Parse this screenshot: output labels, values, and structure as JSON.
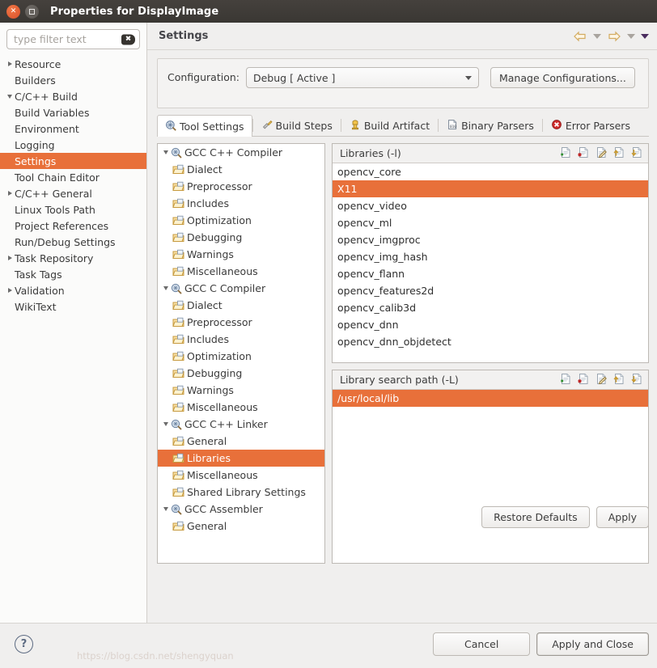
{
  "window": {
    "title": "Properties for DisplayImage",
    "close_icon": "close-icon",
    "maximize_icon": "maximize-icon"
  },
  "sidebar": {
    "filter": {
      "placeholder": "type filter text",
      "value": "",
      "clear_icon": "clear-icon"
    },
    "items": [
      {
        "label": "Resource",
        "expandable": true,
        "expanded": false,
        "indent": 0,
        "selected": false
      },
      {
        "label": "Builders",
        "expandable": false,
        "expanded": false,
        "indent": 0,
        "selected": false
      },
      {
        "label": "C/C++ Build",
        "expandable": true,
        "expanded": true,
        "indent": 0,
        "selected": false
      },
      {
        "label": "Build Variables",
        "expandable": false,
        "expanded": false,
        "indent": 1,
        "selected": false
      },
      {
        "label": "Environment",
        "expandable": false,
        "expanded": false,
        "indent": 1,
        "selected": false
      },
      {
        "label": "Logging",
        "expandable": false,
        "expanded": false,
        "indent": 1,
        "selected": false
      },
      {
        "label": "Settings",
        "expandable": false,
        "expanded": false,
        "indent": 1,
        "selected": true
      },
      {
        "label": "Tool Chain Editor",
        "expandable": false,
        "expanded": false,
        "indent": 1,
        "selected": false
      },
      {
        "label": "C/C++ General",
        "expandable": true,
        "expanded": false,
        "indent": 0,
        "selected": false
      },
      {
        "label": "Linux Tools Path",
        "expandable": false,
        "expanded": false,
        "indent": 0,
        "selected": false
      },
      {
        "label": "Project References",
        "expandable": false,
        "expanded": false,
        "indent": 0,
        "selected": false
      },
      {
        "label": "Run/Debug Settings",
        "expandable": false,
        "expanded": false,
        "indent": 0,
        "selected": false
      },
      {
        "label": "Task Repository",
        "expandable": true,
        "expanded": false,
        "indent": 0,
        "selected": false
      },
      {
        "label": "Task Tags",
        "expandable": false,
        "expanded": false,
        "indent": 0,
        "selected": false
      },
      {
        "label": "Validation",
        "expandable": true,
        "expanded": false,
        "indent": 0,
        "selected": false
      },
      {
        "label": "WikiText",
        "expandable": false,
        "expanded": false,
        "indent": 0,
        "selected": false
      }
    ]
  },
  "header": {
    "title": "Settings",
    "nav": {
      "back_icon": "back-arrow-icon",
      "back_menu_icon": "chevron-down-icon",
      "forward_icon": "forward-arrow-icon",
      "forward_menu_icon": "chevron-down-icon",
      "view_menu_icon": "view-menu-icon"
    }
  },
  "configuration": {
    "label": "Configuration:",
    "value": "Debug  [ Active ]",
    "dropdown_icon": "chevron-down-icon",
    "manage_button": "Manage Configurations..."
  },
  "tabs": [
    {
      "label": "Tool Settings",
      "icon": "tool-settings-icon",
      "active": true
    },
    {
      "label": "Build Steps",
      "icon": "build-steps-icon",
      "active": false
    },
    {
      "label": "Build Artifact",
      "icon": "build-artifact-icon",
      "active": false
    },
    {
      "label": "Binary Parsers",
      "icon": "binary-parsers-icon",
      "active": false
    },
    {
      "label": "Error Parsers",
      "icon": "error-parsers-icon",
      "active": false
    }
  ],
  "tool_tree": [
    {
      "label": "GCC C++ Compiler",
      "type": "tool",
      "expanded": true,
      "indent": 0,
      "selected": false
    },
    {
      "label": "Dialect",
      "type": "folder",
      "indent": 1,
      "selected": false
    },
    {
      "label": "Preprocessor",
      "type": "folder",
      "indent": 1,
      "selected": false
    },
    {
      "label": "Includes",
      "type": "folder",
      "indent": 1,
      "selected": false
    },
    {
      "label": "Optimization",
      "type": "folder",
      "indent": 1,
      "selected": false
    },
    {
      "label": "Debugging",
      "type": "folder",
      "indent": 1,
      "selected": false
    },
    {
      "label": "Warnings",
      "type": "folder",
      "indent": 1,
      "selected": false
    },
    {
      "label": "Miscellaneous",
      "type": "folder",
      "indent": 1,
      "selected": false
    },
    {
      "label": "GCC C Compiler",
      "type": "tool",
      "expanded": true,
      "indent": 0,
      "selected": false
    },
    {
      "label": "Dialect",
      "type": "folder",
      "indent": 1,
      "selected": false
    },
    {
      "label": "Preprocessor",
      "type": "folder",
      "indent": 1,
      "selected": false
    },
    {
      "label": "Includes",
      "type": "folder",
      "indent": 1,
      "selected": false
    },
    {
      "label": "Optimization",
      "type": "folder",
      "indent": 1,
      "selected": false
    },
    {
      "label": "Debugging",
      "type": "folder",
      "indent": 1,
      "selected": false
    },
    {
      "label": "Warnings",
      "type": "folder",
      "indent": 1,
      "selected": false
    },
    {
      "label": "Miscellaneous",
      "type": "folder",
      "indent": 1,
      "selected": false
    },
    {
      "label": "GCC C++ Linker",
      "type": "tool",
      "expanded": true,
      "indent": 0,
      "selected": false
    },
    {
      "label": "General",
      "type": "folder",
      "indent": 1,
      "selected": false
    },
    {
      "label": "Libraries",
      "type": "folder",
      "indent": 1,
      "selected": true
    },
    {
      "label": "Miscellaneous",
      "type": "folder",
      "indent": 1,
      "selected": false
    },
    {
      "label": "Shared Library Settings",
      "type": "folder",
      "indent": 1,
      "selected": false
    },
    {
      "label": "GCC Assembler",
      "type": "tool",
      "expanded": true,
      "indent": 0,
      "selected": false
    },
    {
      "label": "General",
      "type": "folder",
      "indent": 1,
      "selected": false
    }
  ],
  "libraries_panel": {
    "title": "Libraries (-l)",
    "toolbar": [
      {
        "icon": "add-icon"
      },
      {
        "icon": "delete-icon"
      },
      {
        "icon": "edit-icon"
      },
      {
        "icon": "move-up-icon"
      },
      {
        "icon": "move-down-icon"
      }
    ],
    "items": [
      {
        "label": "opencv_core",
        "selected": false
      },
      {
        "label": "X11",
        "selected": true
      },
      {
        "label": "opencv_video",
        "selected": false
      },
      {
        "label": "opencv_ml",
        "selected": false
      },
      {
        "label": "opencv_imgproc",
        "selected": false
      },
      {
        "label": "opencv_img_hash",
        "selected": false
      },
      {
        "label": "opencv_flann",
        "selected": false
      },
      {
        "label": "opencv_features2d",
        "selected": false
      },
      {
        "label": "opencv_calib3d",
        "selected": false
      },
      {
        "label": "opencv_dnn",
        "selected": false
      },
      {
        "label": "opencv_dnn_objdetect",
        "selected": false
      }
    ]
  },
  "search_path_panel": {
    "title": "Library search path (-L)",
    "toolbar": [
      {
        "icon": "add-icon"
      },
      {
        "icon": "delete-icon"
      },
      {
        "icon": "edit-icon"
      },
      {
        "icon": "move-up-icon"
      },
      {
        "icon": "move-down-icon"
      }
    ],
    "items": [
      {
        "label": "/usr/local/lib",
        "selected": true
      }
    ]
  },
  "actions": {
    "restore_defaults": "Restore Defaults",
    "apply": "Apply",
    "cancel": "Cancel",
    "apply_and_close": "Apply and Close",
    "help_icon": "help-icon"
  },
  "watermark": "https://blog.csdn.net/shengyquan",
  "colors": {
    "selection": "#e8703a",
    "titlebar": "#3a3733",
    "sidebar_bg": "#fbfbfa",
    "panel_bg": "#f0efee"
  }
}
